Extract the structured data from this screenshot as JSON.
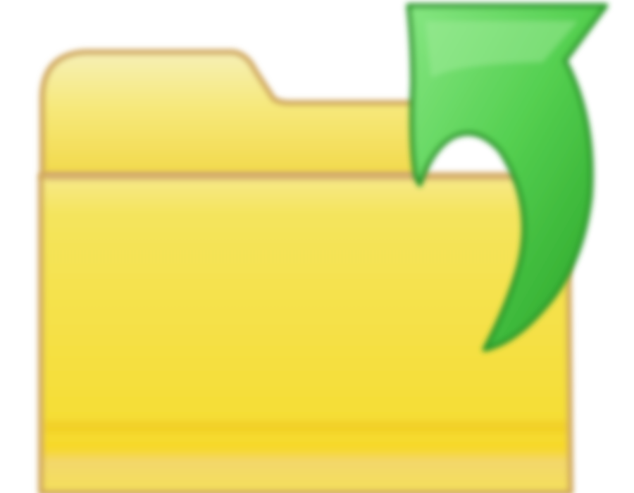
{
  "icon": {
    "name": "open-folder-icon",
    "description_glyphs": {
      "folder": "folder-icon",
      "arrow": "curved-arrow-icon"
    }
  },
  "colors": {
    "folder_light": "#f6e89a",
    "folder_mid": "#f4df5c",
    "folder_deep": "#f7d92a",
    "folder_edge": "#d1a85d",
    "arrow_light": "#7ee07a",
    "arrow_mid": "#48c844",
    "arrow_dark": "#2a9f29",
    "background": "#ffffff"
  }
}
